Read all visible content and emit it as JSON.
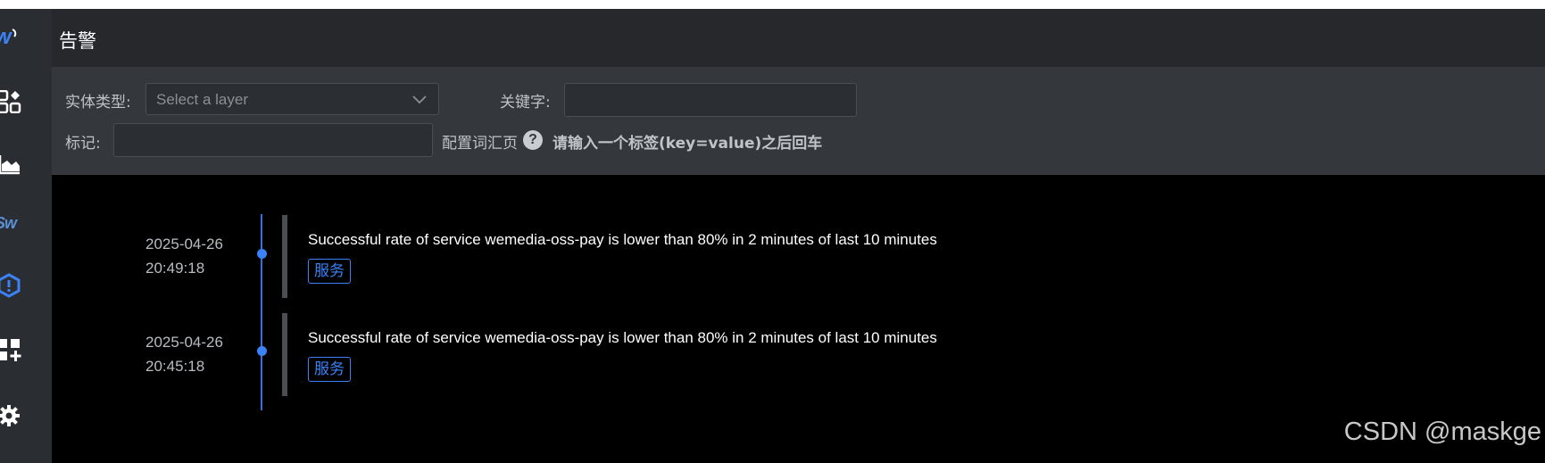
{
  "header": {
    "title": "告警"
  },
  "filters": {
    "entity_type_label": "实体类型:",
    "entity_type_value": "Select a layer",
    "keyword_label": "关键字:",
    "keyword_value": "",
    "tag_label": "标记:",
    "tag_value": "",
    "vocab_link": "配置词汇页",
    "help_glyph": "?",
    "hint": "请输入一个标签(key=value)之后回车"
  },
  "alarms": [
    {
      "date": "2025-04-26",
      "time": "20:49:18",
      "message": "Successful rate of service wemedia-oss-pay is lower than 80% in 2 minutes of last 10 minutes",
      "tag": "服务"
    },
    {
      "date": "2025-04-26",
      "time": "20:45:18",
      "message": "Successful rate of service wemedia-oss-pay is lower than 80% in 2 minutes of last 10 minutes",
      "tag": "服务"
    }
  ],
  "sidebar": {
    "logo_text": "w",
    "items": [
      {
        "icon": "dashboard-icon"
      },
      {
        "icon": "area-chart-icon"
      },
      {
        "icon": "skywalking-logo-icon",
        "text": "Sw"
      },
      {
        "icon": "alarm-hexagon-icon"
      },
      {
        "icon": "add-widget-icon"
      },
      {
        "icon": "gear-icon"
      }
    ]
  },
  "colors": {
    "accent": "#3b82f6",
    "sidebar": "#2a2d31",
    "header": "#26282c",
    "filterbar": "#34373b"
  },
  "watermark": "CSDN @maskge"
}
